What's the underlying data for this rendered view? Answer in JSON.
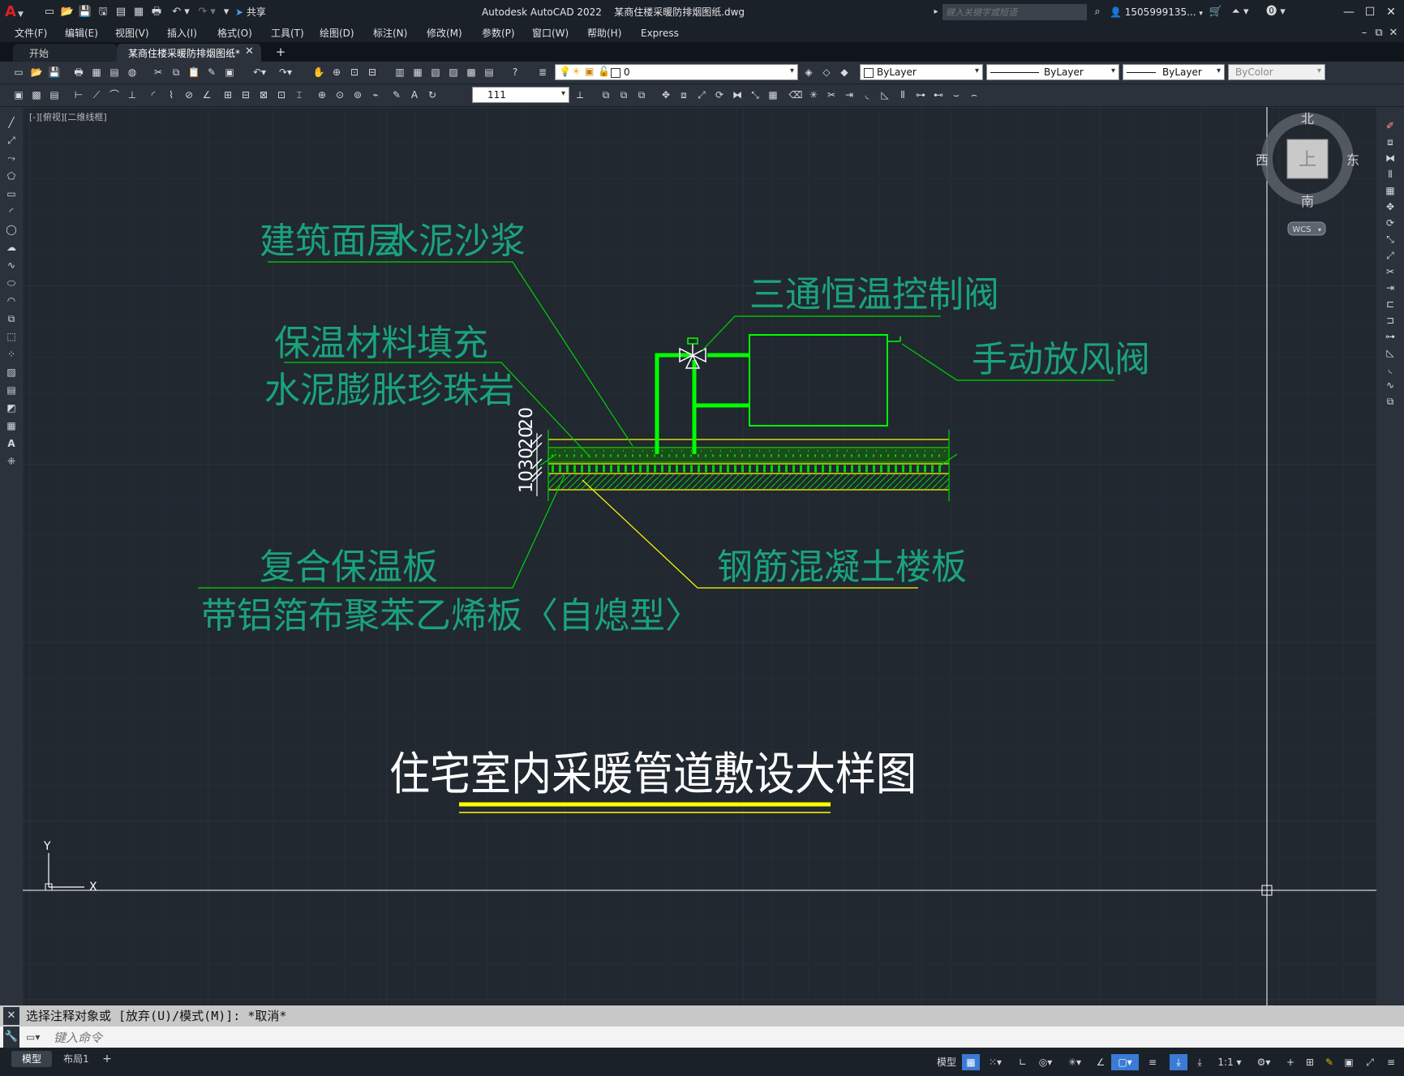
{
  "title_bar": {
    "app_title": "Autodesk AutoCAD 2022",
    "file_name": "某商住楼采暖防排烟图纸.dwg",
    "share_label": "共享",
    "search_placeholder": "键入关键字或短语",
    "user_name": "1505999135...",
    "app_menu_letter": "A"
  },
  "menu": [
    "文件(F)",
    "编辑(E)",
    "视图(V)",
    "插入(I)",
    "格式(O)",
    "工具(T)",
    "绘图(D)",
    "标注(N)",
    "修改(M)",
    "参数(P)",
    "窗口(W)",
    "帮助(H)",
    "Express"
  ],
  "tabs": {
    "start": "开始",
    "active": "某商住楼采暖防排烟图纸*",
    "add": "+"
  },
  "toolbar1": {
    "layer_value": "0",
    "color_value": "ByLayer",
    "linetype_value": "ByLayer",
    "lineweight_value": "ByLayer",
    "plotstyle_value": "ByColor"
  },
  "toolbar2": {
    "dim_style_value": "111"
  },
  "viewport": {
    "label": "[-][俯视][二维线框]"
  },
  "viewcube": {
    "north": "北",
    "south": "南",
    "east": "东",
    "west": "西",
    "face": "上",
    "wcs": "WCS"
  },
  "drawing": {
    "labels": {
      "surface": "建筑面层",
      "mortar": "水泥沙浆",
      "three_way_valve": "三通恒温控制阀",
      "insulation_fill": "保温材料填充",
      "perlite": "水泥膨胀珍珠岩",
      "air_valve": "手动放风阀",
      "composite_board": "复合保温板",
      "foil_board": "带铝箔布聚苯乙烯板〈自熄型〉",
      "rc_slab": "钢筋混凝土楼板",
      "title": "住宅室内采暖管道敷设大样图"
    },
    "dimensions": [
      "20",
      "20",
      "30",
      "10"
    ],
    "ucs_x": "X",
    "ucs_y": "Y"
  },
  "command": {
    "history": "选择注释对象或 [放弃(U)/模式(M)]: *取消*",
    "input_placeholder": "键入命令"
  },
  "status": {
    "model_tab": "模型",
    "layout_tab": "布局1",
    "add_tab": "+",
    "model_button": "模型",
    "scale": "1:1"
  },
  "colors": {
    "canvas_bg": "#212830",
    "drawing_green": "#00d400",
    "label_teal": "#1aa37a",
    "yellow": "#ffff00",
    "accent_blue": "#3a7bd5"
  }
}
